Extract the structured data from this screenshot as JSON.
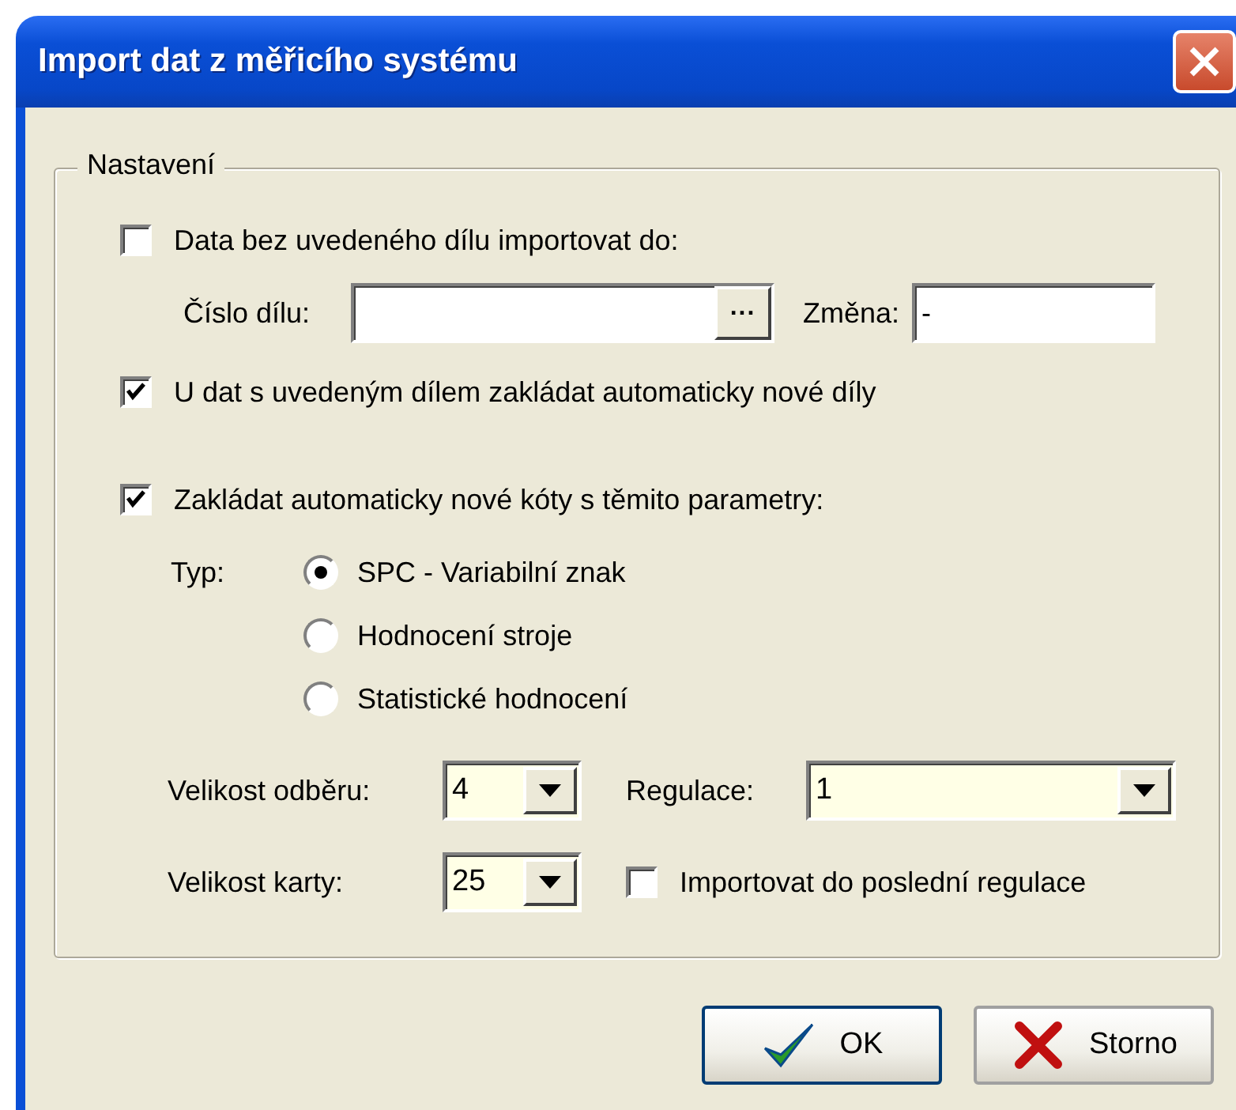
{
  "window": {
    "title": "Import dat z měřicího systému"
  },
  "group": {
    "label": "Nastavení"
  },
  "no_part_checkbox": {
    "label": "Data bez uvedeného dílu importovat do:",
    "checked": false
  },
  "part_fields": [
    {
      "label": "Číslo dílu:",
      "browse_label": "..."
    },
    {
      "label": "Změna:",
      "value": "-"
    }
  ],
  "auto_parts_checkbox": {
    "label": "U dat s uvedeným dílem zakládat automaticky nové díly",
    "checked": true
  },
  "auto_dimensions_checkbox": {
    "label": "Zakládat automaticky nové kóty s těmito parametry:",
    "checked": true
  },
  "type": {
    "label": "Typ:",
    "options": [
      {
        "label": "SPC - Variabilní znak",
        "selected": true
      },
      {
        "label": "Hodnocení stroje",
        "selected": false
      },
      {
        "label": "Statistické hodnocení",
        "selected": false
      }
    ]
  },
  "sample_size": {
    "label": "Velikost odběru:",
    "value": "4"
  },
  "regulation": {
    "label": "Regulace:",
    "value": "1"
  },
  "card_size": {
    "label": "Velikost karty:",
    "value": "25"
  },
  "import_last_checkbox": {
    "label": "Importovat do poslední regulace",
    "checked": false
  },
  "buttons": [
    {
      "kind": "ok",
      "label": "OK"
    },
    {
      "kind": "cancel",
      "label": "Storno"
    }
  ]
}
